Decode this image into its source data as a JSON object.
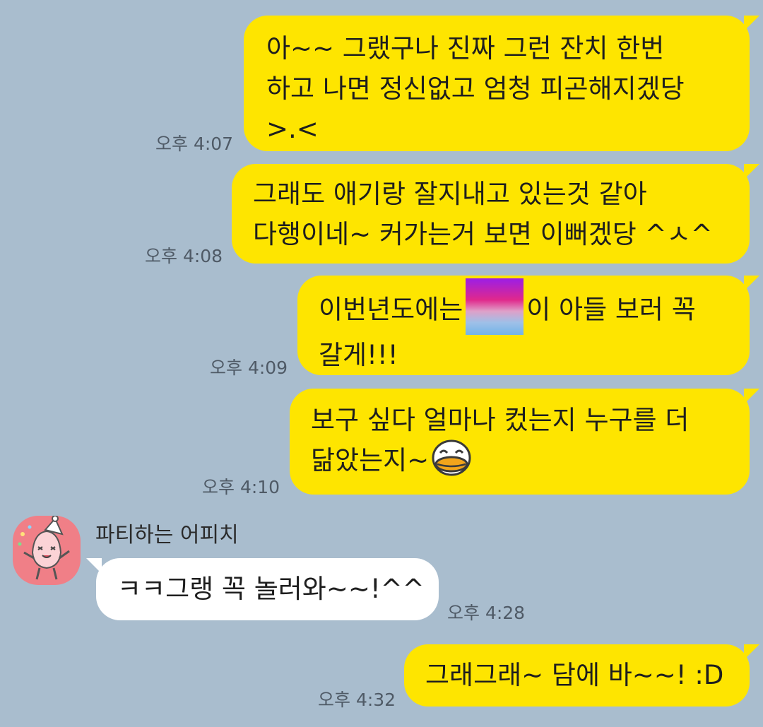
{
  "messages": [
    {
      "lines": [
        "아~~ 그랬구나 진짜 그런 잔치 한번",
        "하고 나면 정신없고 엄청 피곤해지겠당",
        ">.<"
      ],
      "time": "오후 4:07"
    },
    {
      "lines": [
        "그래도 애기랑 잘지내고 있는것 같아",
        "다행이네~ 커가는거 보면 이뻐겠당 ^ㅅ^"
      ],
      "time": "오후 4:08"
    },
    {
      "line1_before": "이번년도에는",
      "line1_after": "이 아들 보러 꼭",
      "line2": "갈게!!!",
      "time": "오후 4:09"
    },
    {
      "line1": "보구 싶다 얼마나 컸는지 누구를 더",
      "line2": "닮았는지~",
      "emoticon": "laughing-face-icon",
      "time": "오후 4:10"
    },
    {
      "text": "ㅋㅋ그랭 꼭 놀러와~~!^^",
      "time": "오후 4:28"
    },
    {
      "text": "그래그래~ 담에 바~~! :D",
      "time": "오후 4:32"
    }
  ],
  "sender": {
    "name": "파티하는 어피치",
    "avatar_icon": "party-peach-avatar"
  },
  "colors": {
    "background": "#a9bdce",
    "my_bubble": "#fee500",
    "their_bubble": "#ffffff"
  }
}
